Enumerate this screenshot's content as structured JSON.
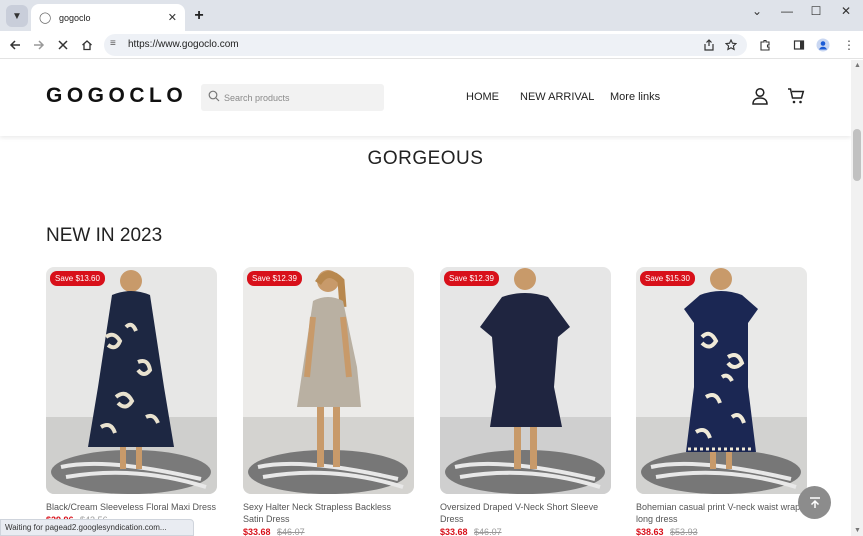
{
  "browser": {
    "tab_title": "gogoclo",
    "url": "https://www.gogoclo.com",
    "status_text": "Waiting for pagead2.googlesyndication.com..."
  },
  "site": {
    "logo": "GOGOCLO",
    "search_placeholder": "Search products",
    "nav": [
      "HOME",
      "NEW ARRIVAL",
      "More links"
    ],
    "hero_text": "GORGEOUS",
    "section_title": "NEW IN 2023"
  },
  "products": [
    {
      "badge": "Save $13.60",
      "name": "Black/Cream Sleeveless Floral Maxi Dress",
      "price": "$29.96",
      "old_price": "$43.56",
      "dress_color": "#1d2742",
      "pattern": "#e9e2cf"
    },
    {
      "badge": "Save $12.39",
      "name": "Sexy Halter Neck Strapless Backless Satin Dress",
      "price": "$33.68",
      "old_price": "$46.07",
      "dress_color": "#b9b0a2",
      "pattern": ""
    },
    {
      "badge": "Save $12.39",
      "name": "Oversized Draped V-Neck Short Sleeve Dress",
      "price": "$33.68",
      "old_price": "$46.07",
      "dress_color": "#1f2540",
      "pattern": ""
    },
    {
      "badge": "Save $15.30",
      "name": "Bohemian casual print V-neck waist wrap long dress",
      "price": "$38.63",
      "old_price": "$53.93",
      "dress_color": "#1b2753",
      "pattern": "#f0ead8"
    }
  ],
  "colors": {
    "accent_red": "#d8101a",
    "chrome_bg": "#dfe3ea",
    "scroll_top_btn": "#8c8c8c"
  }
}
